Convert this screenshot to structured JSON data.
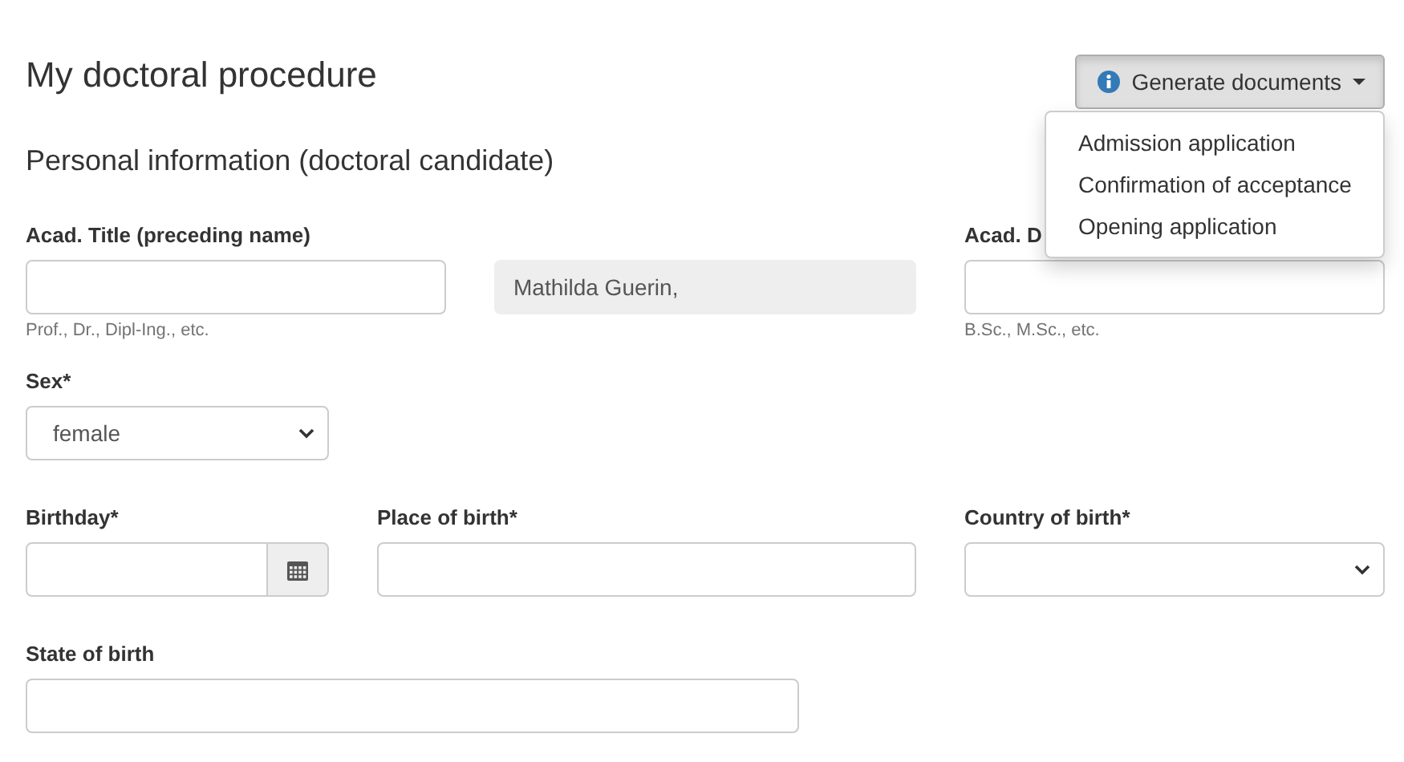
{
  "title": "My doctoral procedure",
  "generate_button": {
    "label": "Generate documents",
    "expanded": true
  },
  "menu_items": [
    {
      "label": "Admission application"
    },
    {
      "label": "Confirmation of acceptance"
    },
    {
      "label": "Opening application"
    }
  ],
  "section_title": "Personal information (doctoral candidate)",
  "name_row": [
    {
      "kind": "input",
      "label": "Acad. Title (preceding name)",
      "help": "Prof., Dr., Dipl-Ing., etc."
    },
    {
      "kind": "readonly",
      "value": "Mathilda Guerin,"
    },
    {
      "kind": "input",
      "label": "Acad. D",
      "help": "B.Sc., M.Sc., etc."
    }
  ],
  "sex": {
    "label": "Sex*",
    "value": "female"
  },
  "birth_row": [
    {
      "kind": "date",
      "label": "Birthday*"
    },
    {
      "kind": "input",
      "label": "Place of birth*"
    },
    {
      "kind": "select",
      "label": "Country of birth*"
    }
  ],
  "state_of_birth": {
    "label": "State of birth"
  }
}
